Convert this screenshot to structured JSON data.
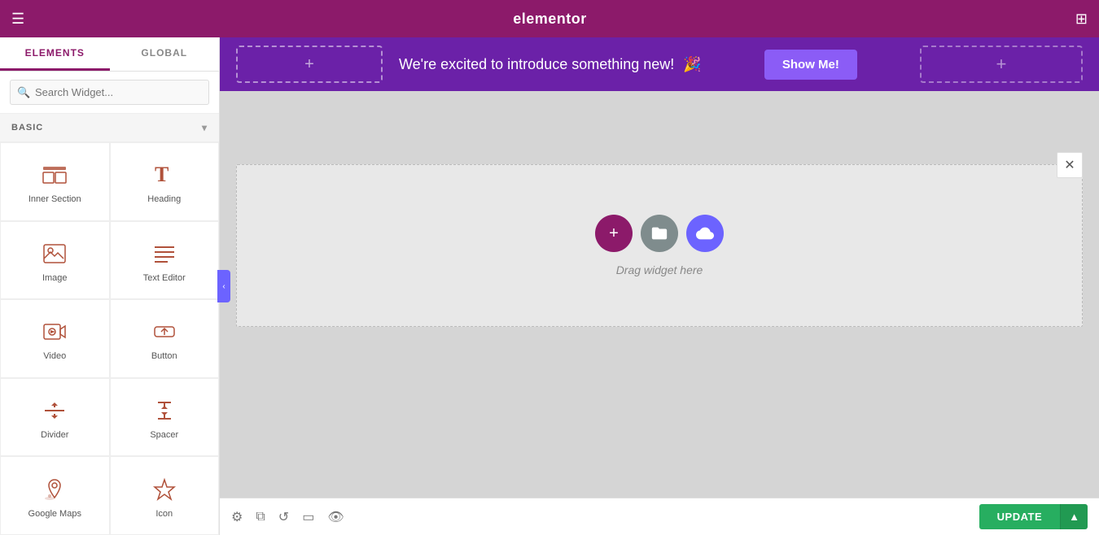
{
  "topBar": {
    "title": "elementor",
    "hamburger": "☰",
    "grid": "⊞"
  },
  "sidebar": {
    "tabs": [
      {
        "id": "elements",
        "label": "ELEMENTS",
        "active": true
      },
      {
        "id": "global",
        "label": "GLOBAL",
        "active": false
      }
    ],
    "search": {
      "placeholder": "Search Widget..."
    },
    "basicSection": {
      "label": "BASIC"
    },
    "widgets": [
      {
        "id": "inner-section",
        "label": "Inner Section"
      },
      {
        "id": "heading",
        "label": "Heading"
      },
      {
        "id": "image",
        "label": "Image"
      },
      {
        "id": "text-editor",
        "label": "Text Editor"
      },
      {
        "id": "video",
        "label": "Video"
      },
      {
        "id": "button",
        "label": "Button"
      },
      {
        "id": "divider",
        "label": "Divider"
      },
      {
        "id": "spacer",
        "label": "Spacer"
      },
      {
        "id": "google-maps",
        "label": "Google Maps"
      },
      {
        "id": "icon",
        "label": "Icon"
      }
    ]
  },
  "promoBanner": {
    "addBtn": "+",
    "text": "We're excited to introduce something new!",
    "emoji": "🎉",
    "showMeLabel": "Show Me!",
    "rightAdd": "+"
  },
  "canvas": {
    "dragText": "Drag widget here",
    "closeBtn": "✕"
  },
  "bottomToolbar": {
    "updateLabel": "UPDATE",
    "arrowLabel": "▲"
  }
}
